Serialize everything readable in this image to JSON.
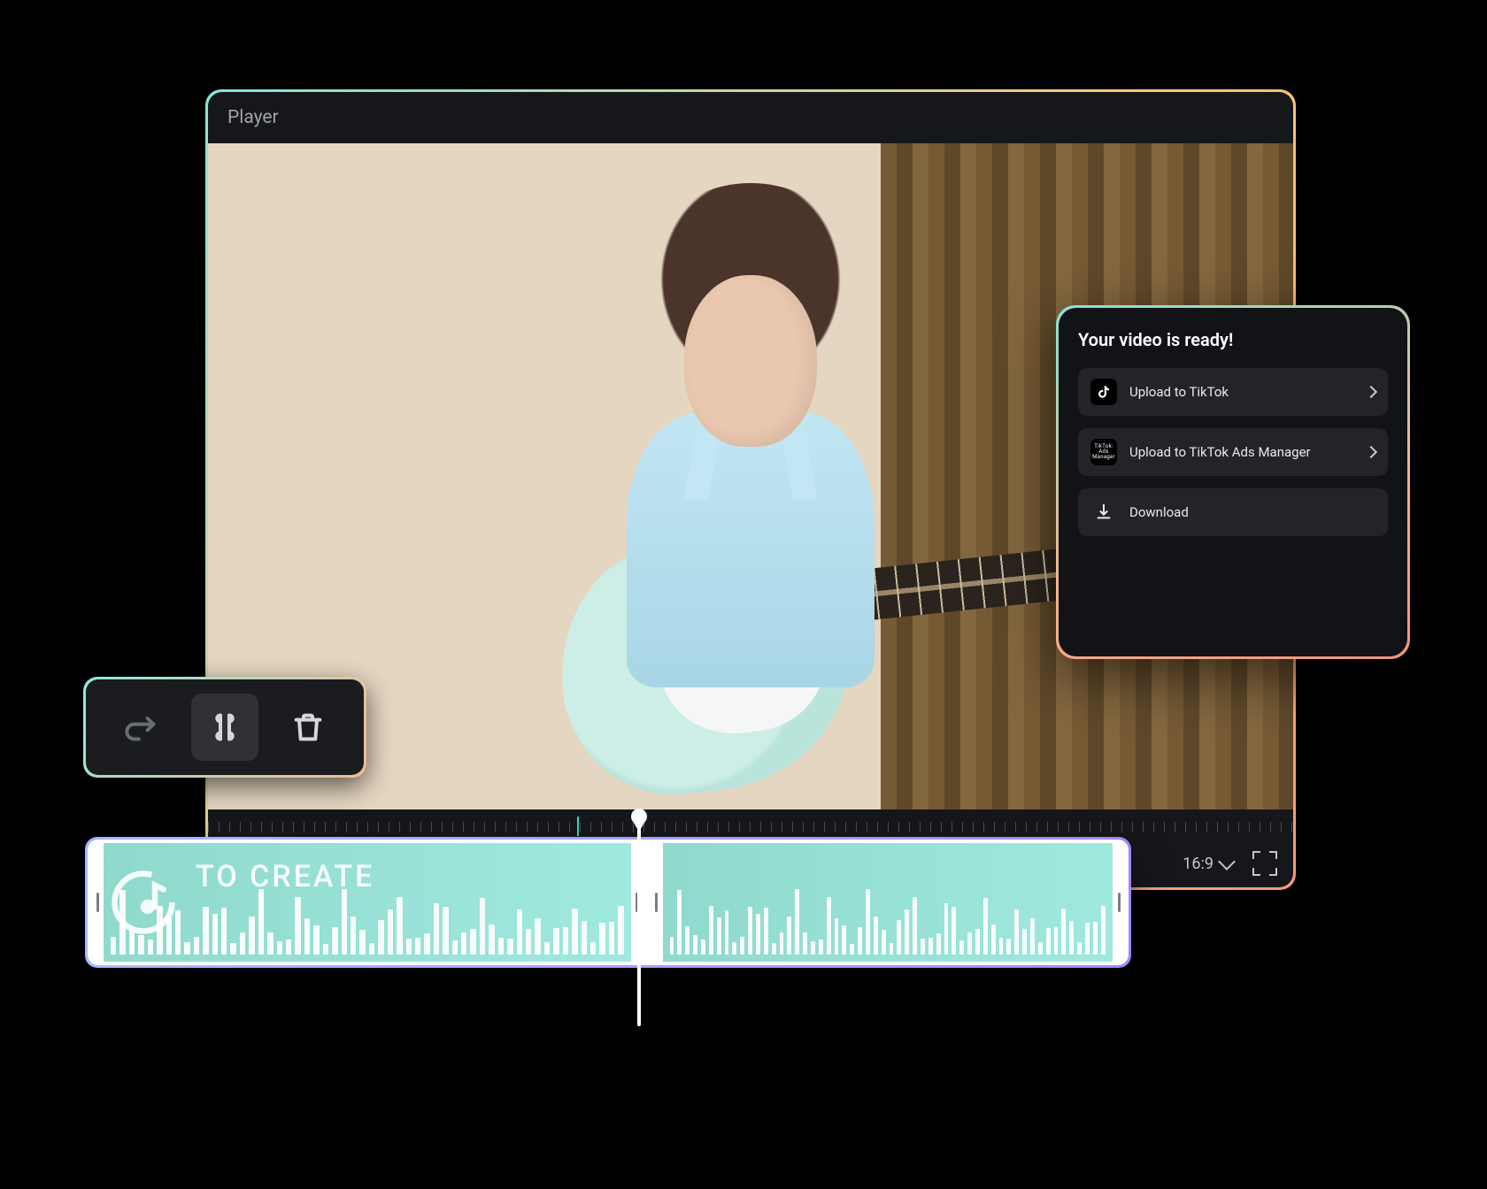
{
  "player": {
    "title": "Player",
    "aspect_ratio": "16:9"
  },
  "toolbar": {
    "redo_name": "redo",
    "split_name": "split",
    "delete_name": "delete"
  },
  "audio_track": {
    "clip_label": "TO CREATE"
  },
  "export_modal": {
    "title": "Your video is ready!",
    "upload_tiktok": "Upload to TikTok",
    "upload_ads": "Upload to TikTok Ads Manager",
    "ads_badge": "TikTok: Ads Manager",
    "download": "Download"
  }
}
